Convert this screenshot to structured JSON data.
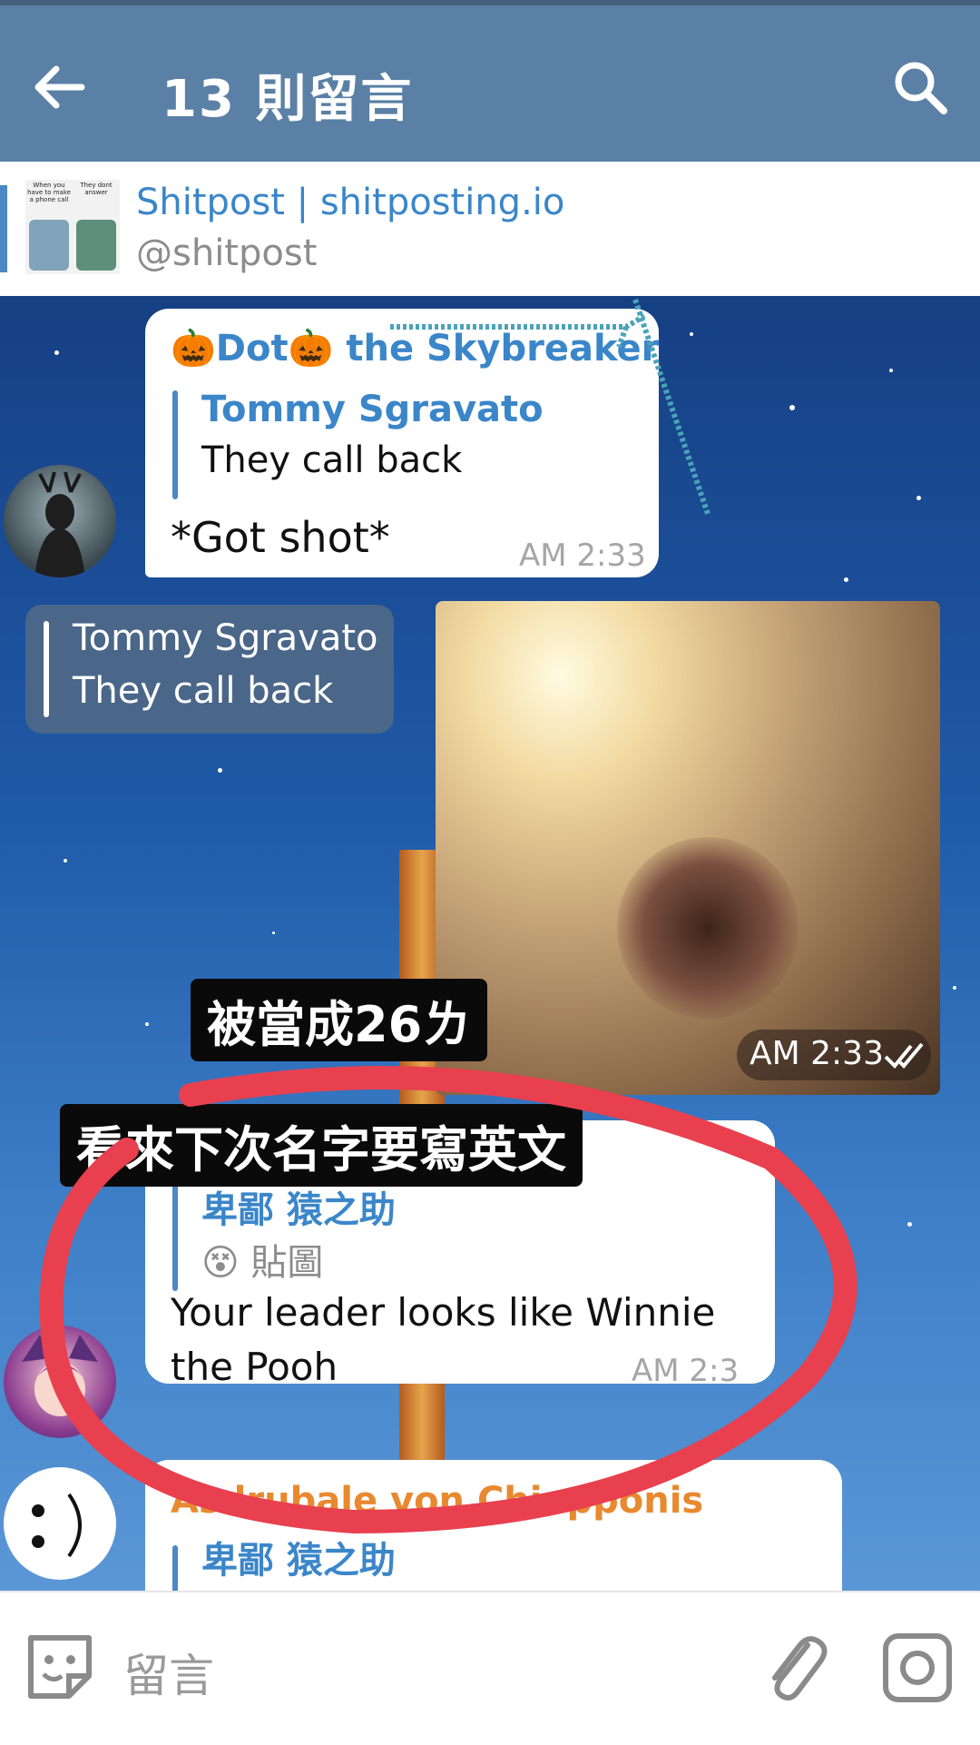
{
  "header": {
    "title": "13 則留言"
  },
  "channel": {
    "name": "Shitpost | shitposting.io",
    "handle": "@shitpost",
    "thumb_left_text": "When you have to make a phone call",
    "thumb_right_text": "They dont answer"
  },
  "messages": [
    {
      "sender": "🎃Dot🎃 the Skybreaker",
      "reply_name": "Tommy Sgravato",
      "reply_text": "They call back",
      "text": "*Got shot*",
      "time": "AM 2:33"
    },
    {
      "reply_name": "Tommy Sgravato",
      "reply_text": "They call back",
      "time": "AM 2:33"
    },
    {
      "reply_name": "卑鄙 猿之助",
      "reply_text": "😵 貼圖",
      "text": "Your leader looks like Winnie the Pooh",
      "time": "AM 2:3"
    },
    {
      "sender": "Asdrubale von Chiapponis",
      "reply_name": "卑鄙 猿之助"
    }
  ],
  "captions": {
    "first": "被當成26ㄌ",
    "second": "看來下次名字要寫英文"
  },
  "input": {
    "placeholder": "留言"
  },
  "icons": {
    "back": "arrow-left-icon",
    "search": "search-icon",
    "emoji": "sticker-icon",
    "attach": "paperclip-icon",
    "camera": "camera-icon"
  },
  "colors": {
    "topbar": "#5a80a6",
    "link": "#3b86c9",
    "orange_sender": "#e8892f",
    "circle": "#e8404e"
  }
}
